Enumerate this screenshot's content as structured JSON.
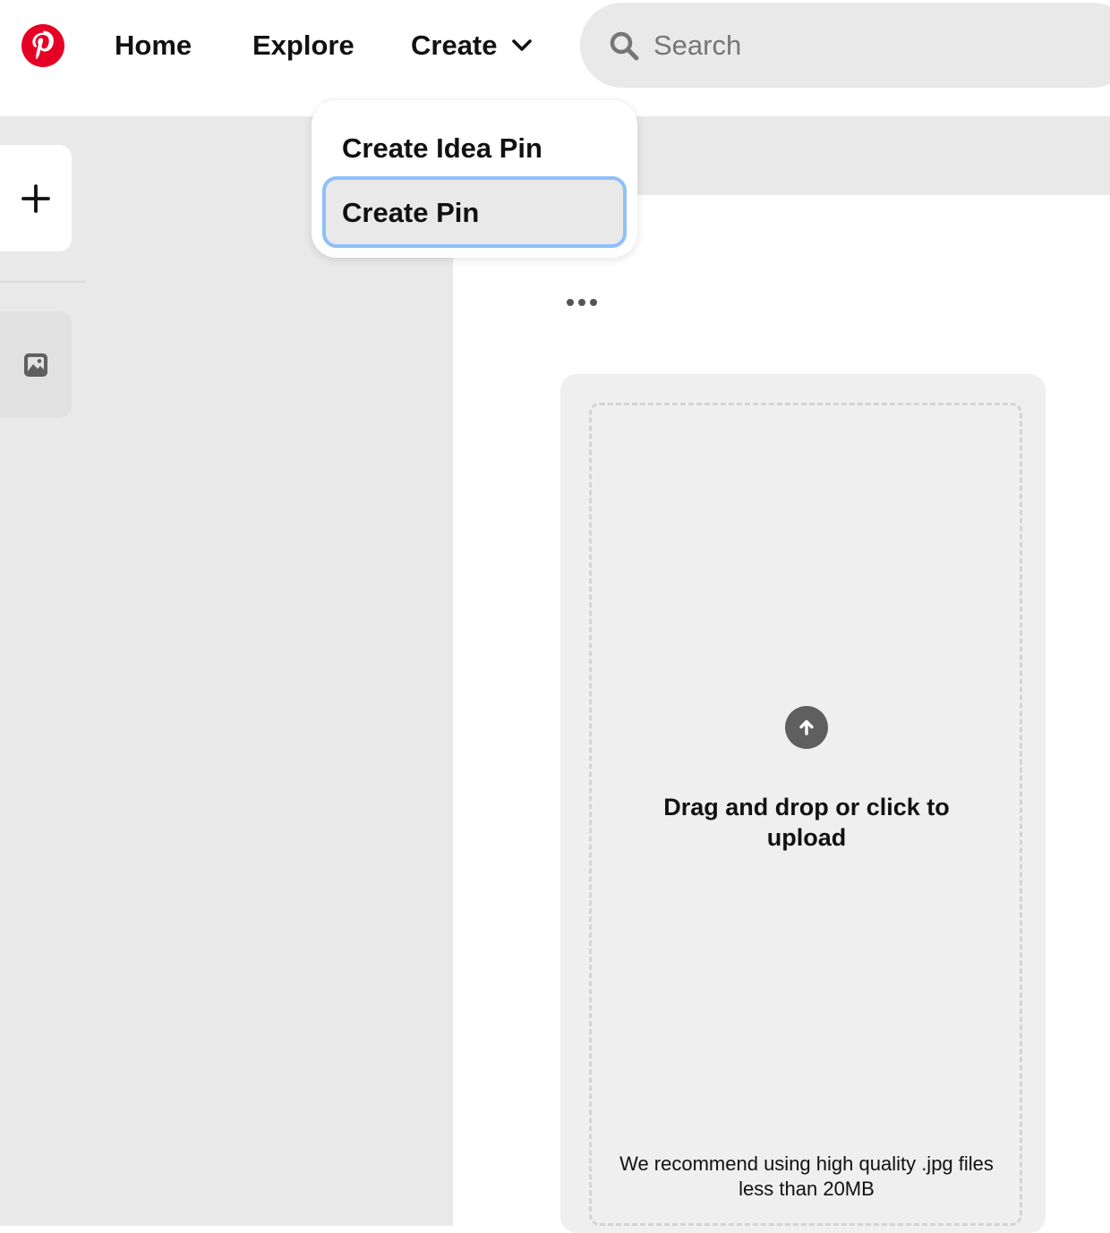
{
  "brand": {
    "logo_icon": "pinterest-logo-icon",
    "color": "#e60023"
  },
  "nav": {
    "home": "Home",
    "explore": "Explore",
    "create": "Create",
    "create_chevron_icon": "chevron-down-icon"
  },
  "search": {
    "placeholder": "Search",
    "value": "",
    "icon": "search-icon"
  },
  "dropdown": {
    "items": [
      {
        "label": "Create Idea Pin"
      },
      {
        "label": "Create Pin",
        "focused": true
      }
    ],
    "focus_ring_color": "#8ec0fb"
  },
  "sidebar": {
    "add_icon": "plus-icon",
    "thumbnail_icon": "image-icon"
  },
  "editor": {
    "more_icon": "more-options-icon",
    "upload": {
      "icon": "upload-arrow-icon",
      "title": "Drag and drop or click to upload",
      "note": "We recommend using high quality .jpg files less than 20MB"
    }
  }
}
